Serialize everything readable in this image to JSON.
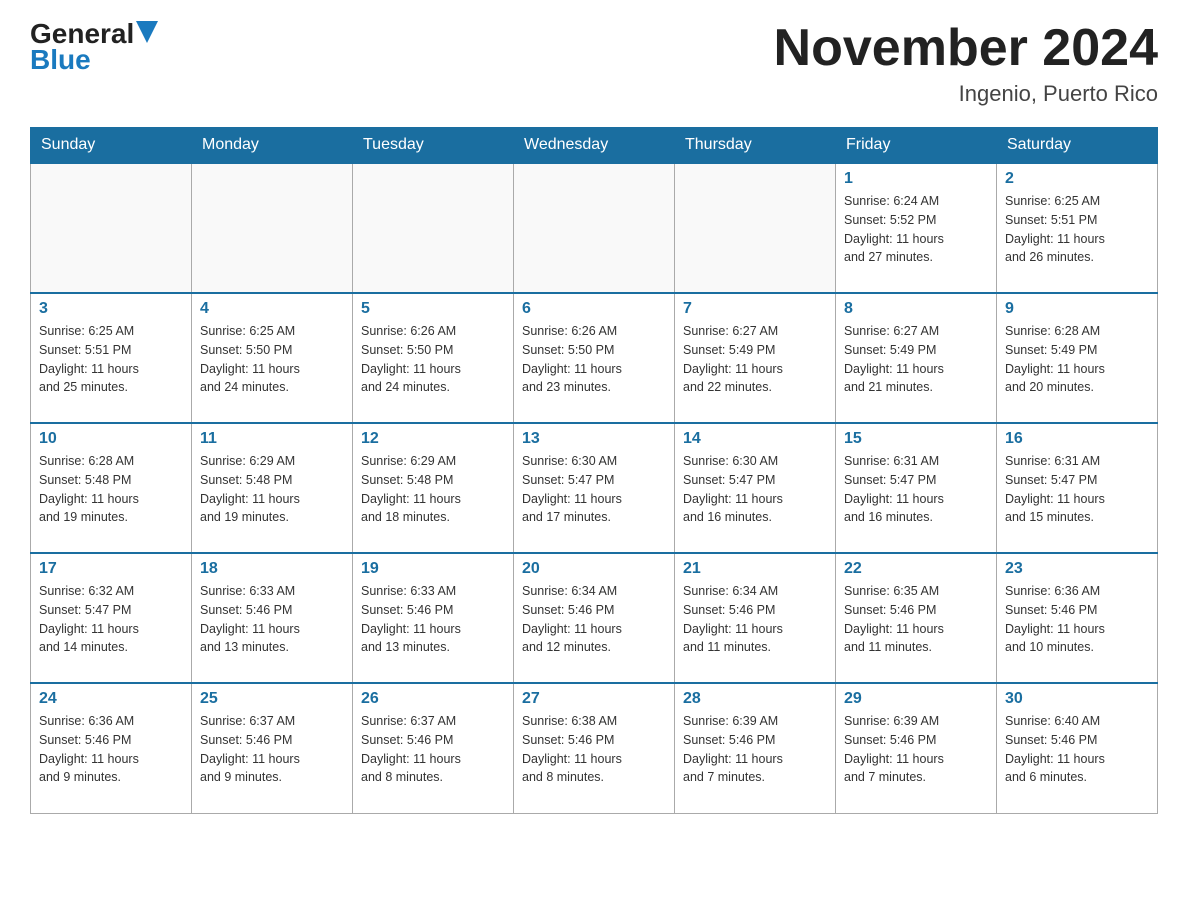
{
  "header": {
    "logo_general": "General",
    "logo_blue": "Blue",
    "title": "November 2024",
    "subtitle": "Ingenio, Puerto Rico"
  },
  "weekdays": [
    "Sunday",
    "Monday",
    "Tuesday",
    "Wednesday",
    "Thursday",
    "Friday",
    "Saturday"
  ],
  "weeks": [
    [
      {
        "day": "",
        "info": ""
      },
      {
        "day": "",
        "info": ""
      },
      {
        "day": "",
        "info": ""
      },
      {
        "day": "",
        "info": ""
      },
      {
        "day": "",
        "info": ""
      },
      {
        "day": "1",
        "info": "Sunrise: 6:24 AM\nSunset: 5:52 PM\nDaylight: 11 hours\nand 27 minutes."
      },
      {
        "day": "2",
        "info": "Sunrise: 6:25 AM\nSunset: 5:51 PM\nDaylight: 11 hours\nand 26 minutes."
      }
    ],
    [
      {
        "day": "3",
        "info": "Sunrise: 6:25 AM\nSunset: 5:51 PM\nDaylight: 11 hours\nand 25 minutes."
      },
      {
        "day": "4",
        "info": "Sunrise: 6:25 AM\nSunset: 5:50 PM\nDaylight: 11 hours\nand 24 minutes."
      },
      {
        "day": "5",
        "info": "Sunrise: 6:26 AM\nSunset: 5:50 PM\nDaylight: 11 hours\nand 24 minutes."
      },
      {
        "day": "6",
        "info": "Sunrise: 6:26 AM\nSunset: 5:50 PM\nDaylight: 11 hours\nand 23 minutes."
      },
      {
        "day": "7",
        "info": "Sunrise: 6:27 AM\nSunset: 5:49 PM\nDaylight: 11 hours\nand 22 minutes."
      },
      {
        "day": "8",
        "info": "Sunrise: 6:27 AM\nSunset: 5:49 PM\nDaylight: 11 hours\nand 21 minutes."
      },
      {
        "day": "9",
        "info": "Sunrise: 6:28 AM\nSunset: 5:49 PM\nDaylight: 11 hours\nand 20 minutes."
      }
    ],
    [
      {
        "day": "10",
        "info": "Sunrise: 6:28 AM\nSunset: 5:48 PM\nDaylight: 11 hours\nand 19 minutes."
      },
      {
        "day": "11",
        "info": "Sunrise: 6:29 AM\nSunset: 5:48 PM\nDaylight: 11 hours\nand 19 minutes."
      },
      {
        "day": "12",
        "info": "Sunrise: 6:29 AM\nSunset: 5:48 PM\nDaylight: 11 hours\nand 18 minutes."
      },
      {
        "day": "13",
        "info": "Sunrise: 6:30 AM\nSunset: 5:47 PM\nDaylight: 11 hours\nand 17 minutes."
      },
      {
        "day": "14",
        "info": "Sunrise: 6:30 AM\nSunset: 5:47 PM\nDaylight: 11 hours\nand 16 minutes."
      },
      {
        "day": "15",
        "info": "Sunrise: 6:31 AM\nSunset: 5:47 PM\nDaylight: 11 hours\nand 16 minutes."
      },
      {
        "day": "16",
        "info": "Sunrise: 6:31 AM\nSunset: 5:47 PM\nDaylight: 11 hours\nand 15 minutes."
      }
    ],
    [
      {
        "day": "17",
        "info": "Sunrise: 6:32 AM\nSunset: 5:47 PM\nDaylight: 11 hours\nand 14 minutes."
      },
      {
        "day": "18",
        "info": "Sunrise: 6:33 AM\nSunset: 5:46 PM\nDaylight: 11 hours\nand 13 minutes."
      },
      {
        "day": "19",
        "info": "Sunrise: 6:33 AM\nSunset: 5:46 PM\nDaylight: 11 hours\nand 13 minutes."
      },
      {
        "day": "20",
        "info": "Sunrise: 6:34 AM\nSunset: 5:46 PM\nDaylight: 11 hours\nand 12 minutes."
      },
      {
        "day": "21",
        "info": "Sunrise: 6:34 AM\nSunset: 5:46 PM\nDaylight: 11 hours\nand 11 minutes."
      },
      {
        "day": "22",
        "info": "Sunrise: 6:35 AM\nSunset: 5:46 PM\nDaylight: 11 hours\nand 11 minutes."
      },
      {
        "day": "23",
        "info": "Sunrise: 6:36 AM\nSunset: 5:46 PM\nDaylight: 11 hours\nand 10 minutes."
      }
    ],
    [
      {
        "day": "24",
        "info": "Sunrise: 6:36 AM\nSunset: 5:46 PM\nDaylight: 11 hours\nand 9 minutes."
      },
      {
        "day": "25",
        "info": "Sunrise: 6:37 AM\nSunset: 5:46 PM\nDaylight: 11 hours\nand 9 minutes."
      },
      {
        "day": "26",
        "info": "Sunrise: 6:37 AM\nSunset: 5:46 PM\nDaylight: 11 hours\nand 8 minutes."
      },
      {
        "day": "27",
        "info": "Sunrise: 6:38 AM\nSunset: 5:46 PM\nDaylight: 11 hours\nand 8 minutes."
      },
      {
        "day": "28",
        "info": "Sunrise: 6:39 AM\nSunset: 5:46 PM\nDaylight: 11 hours\nand 7 minutes."
      },
      {
        "day": "29",
        "info": "Sunrise: 6:39 AM\nSunset: 5:46 PM\nDaylight: 11 hours\nand 7 minutes."
      },
      {
        "day": "30",
        "info": "Sunrise: 6:40 AM\nSunset: 5:46 PM\nDaylight: 11 hours\nand 6 minutes."
      }
    ]
  ]
}
